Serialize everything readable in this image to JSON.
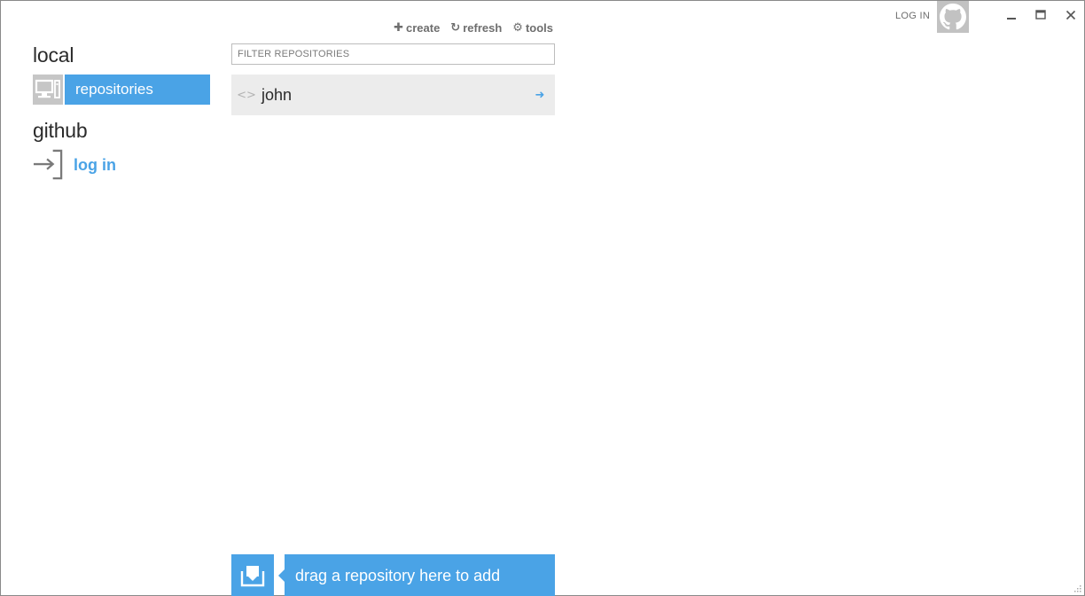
{
  "window": {
    "login_label": "LOG IN",
    "icons": [
      "github-octocat-icon",
      "minimize-icon",
      "maximize-icon",
      "close-icon"
    ]
  },
  "sidebar": {
    "sections": [
      {
        "title": "local",
        "items": [
          {
            "label": "repositories",
            "icon": "computer-icon",
            "active": true
          }
        ]
      },
      {
        "title": "github",
        "items": [
          {
            "label": "log in",
            "icon": "login-arrow-icon",
            "active": false
          }
        ]
      }
    ]
  },
  "toolbar": {
    "create_label": "create",
    "refresh_label": "refresh",
    "tools_label": "tools"
  },
  "filter": {
    "placeholder": "FILTER REPOSITORIES",
    "value": ""
  },
  "repositories": [
    {
      "name": "john"
    }
  ],
  "dropzone": {
    "label": "drag a repository here to add"
  },
  "colors": {
    "accent": "#4aa3e6",
    "item_bg": "#ececec",
    "icon_bg": "#c6c6c6"
  }
}
